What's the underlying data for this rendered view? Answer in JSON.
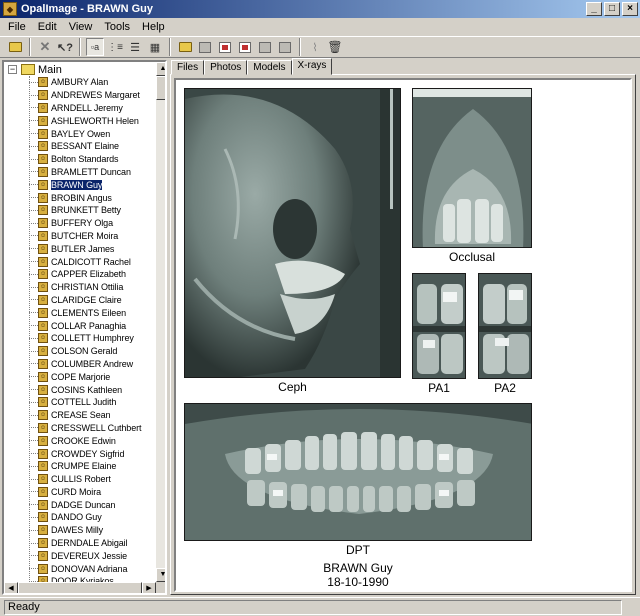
{
  "window": {
    "title": "OpalImage - BRAWN Guy"
  },
  "menu": [
    "File",
    "Edit",
    "View",
    "Tools",
    "Help"
  ],
  "tree": {
    "root_label": "Main",
    "selected": "BRAWN Guy",
    "patients": [
      "AMBURY Alan",
      "ANDREWES Margaret",
      "ARNDELL Jeremy",
      "ASHLEWORTH Helen",
      "BAYLEY Owen",
      "BESSANT Elaine",
      "Bolton Standards",
      "BRAMLETT Duncan",
      "BRAWN Guy",
      "BROBIN Angus",
      "BRUNKETT Betty",
      "BUFFERY Olga",
      "BUTCHER Moira",
      "BUTLER James",
      "CALDICOTT Rachel",
      "CAPPER Elizabeth",
      "CHRISTIAN Ottilia",
      "CLARIDGE Claire",
      "CLEMENTS Eileen",
      "COLLAR Panaghia",
      "COLLETT Humphrey",
      "COLSON Gerald",
      "COLUMBER Andrew",
      "COPE Marjorie",
      "COSINS Kathleen",
      "COTTELL Judith",
      "CREASE Sean",
      "CRESSWELL Cuthbert",
      "CROOKE Edwin",
      "CROWDEY Sigfrid",
      "CRUMPE Elaine",
      "CULLIS Robert",
      "CURD Moira",
      "DADGE Duncan",
      "DANDO Guy",
      "DAWES Milly",
      "DERNDALE Abigail",
      "DEVEREUX Jessie",
      "DONOVAN Adriana",
      "DOOR Kyriakos"
    ]
  },
  "tabs": [
    "Files",
    "Photos",
    "Models",
    "X-rays"
  ],
  "active_tab": "X-rays",
  "xrays": {
    "ceph": "Ceph",
    "occlusal": "Occlusal",
    "pa1": "PA1",
    "pa2": "PA2",
    "dpt": "DPT"
  },
  "patient": {
    "name": "BRAWN Guy",
    "dob": "18-10-1990"
  },
  "status": "Ready"
}
